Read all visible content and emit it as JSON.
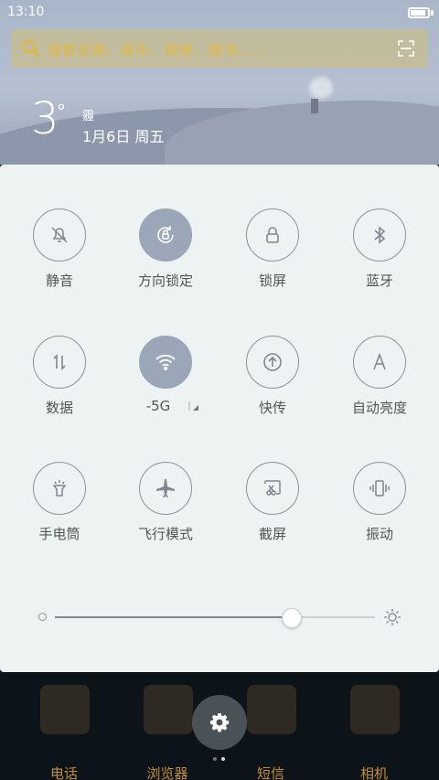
{
  "status": {
    "time": "13:10"
  },
  "search": {
    "placeholder": "搜索应用、音乐、视频、图书……"
  },
  "weather": {
    "temperature": "3",
    "degree": "°",
    "condition": "霾",
    "date": "1月6日 周五"
  },
  "quick_settings": [
    {
      "label": "静音",
      "icon": "bell-off-icon",
      "active": false
    },
    {
      "label": "方向锁定",
      "icon": "rotation-lock-icon",
      "active": true
    },
    {
      "label": "锁屏",
      "icon": "lock-icon",
      "active": false
    },
    {
      "label": "蓝牙",
      "icon": "bluetooth-icon",
      "active": false
    },
    {
      "label": "数据",
      "icon": "data-arrows-icon",
      "active": false
    },
    {
      "label": "-5G",
      "icon": "wifi-icon",
      "active": true
    },
    {
      "label": "快传",
      "icon": "upload-icon",
      "active": false
    },
    {
      "label": "自动亮度",
      "icon": "auto-brightness-icon",
      "active": false
    },
    {
      "label": "手电筒",
      "icon": "flashlight-icon",
      "active": false
    },
    {
      "label": "飞行模式",
      "icon": "airplane-icon",
      "active": false
    },
    {
      "label": "截屏",
      "icon": "screenshot-icon",
      "active": false
    },
    {
      "label": "振动",
      "icon": "vibrate-icon",
      "active": false
    }
  ],
  "brightness": {
    "level_percent": 74
  },
  "dock": [
    {
      "label": "电话"
    },
    {
      "label": "浏览器"
    },
    {
      "label": "短信"
    },
    {
      "label": "相机"
    }
  ],
  "colors": {
    "active_tile": "#9ba6b9",
    "panel_bg": "#edf2f3",
    "dock_label": "#c68e3a",
    "search_text": "#e3b93a"
  }
}
